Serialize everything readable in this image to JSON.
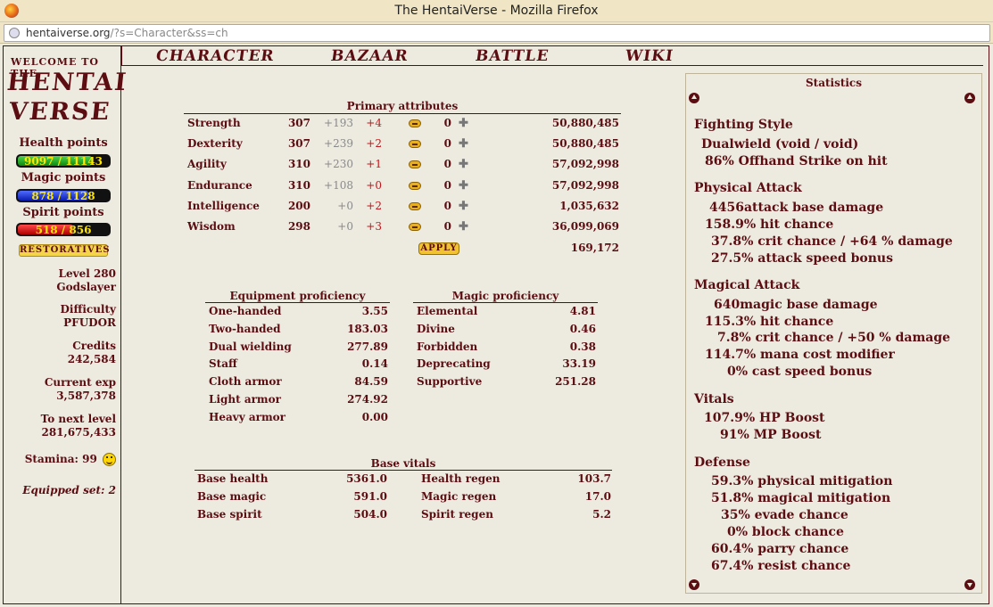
{
  "browser": {
    "window_title": "The HentaiVerse - Mozilla Firefox",
    "url_host": "hentaiverse.org",
    "url_path": "/?s=Character&ss=ch"
  },
  "menu": [
    "CHARACTER",
    "BAZAAR",
    "BATTLE",
    "WIKI"
  ],
  "left": {
    "welcome": "WELCOME TO THE",
    "logo_line1": "HENTAI",
    "logo_line2": "VERSE",
    "health_label": "Health points",
    "health_value": "9097 / 11143",
    "health_fraction": 0.816,
    "magic_label": "Magic points",
    "magic_value": "878 / 1128",
    "magic_fraction": 0.778,
    "spirit_label": "Spirit points",
    "spirit_value": "518 / 856",
    "spirit_fraction": 0.605,
    "restoratives": "RESTORATIVES",
    "level": "Level 280",
    "title": "Godslayer",
    "difficulty_label": "Difficulty",
    "difficulty_value": "PFUDOR",
    "credits_label": "Credits",
    "credits_value": "242,584",
    "exp_label": "Current exp",
    "exp_value": "3,587,378",
    "next_label": "To next level",
    "next_value": "281,675,433",
    "stamina": "Stamina: 99",
    "equipped_set": "Equipped set: 2"
  },
  "primary": {
    "title": "Primary attributes",
    "rows": [
      {
        "name": "Strength",
        "base": "307",
        "bonus": "+193",
        "delta": "+4",
        "spent": "0",
        "exp": "50,880,485"
      },
      {
        "name": "Dexterity",
        "base": "307",
        "bonus": "+239",
        "delta": "+2",
        "spent": "0",
        "exp": "50,880,485"
      },
      {
        "name": "Agility",
        "base": "310",
        "bonus": "+230",
        "delta": "+1",
        "spent": "0",
        "exp": "57,092,998"
      },
      {
        "name": "Endurance",
        "base": "310",
        "bonus": "+108",
        "delta": "+0",
        "spent": "0",
        "exp": "57,092,998"
      },
      {
        "name": "Intelligence",
        "base": "200",
        "bonus": "+0",
        "delta": "+2",
        "spent": "0",
        "exp": "1,035,632"
      },
      {
        "name": "Wisdom",
        "base": "298",
        "bonus": "+0",
        "delta": "+3",
        "spent": "0",
        "exp": "36,099,069"
      }
    ],
    "apply": "APPLY",
    "total_exp": "169,172"
  },
  "equipment_prof": {
    "title": "Equipment proficiency",
    "rows": [
      {
        "name": "One-handed",
        "value": "3.55"
      },
      {
        "name": "Two-handed",
        "value": "183.03"
      },
      {
        "name": "Dual wielding",
        "value": "277.89"
      },
      {
        "name": "Staff",
        "value": "0.14"
      },
      {
        "name": "Cloth armor",
        "value": "84.59"
      },
      {
        "name": "Light armor",
        "value": "274.92"
      },
      {
        "name": "Heavy armor",
        "value": "0.00"
      }
    ]
  },
  "magic_prof": {
    "title": "Magic proficiency",
    "rows": [
      {
        "name": "Elemental",
        "value": "4.81"
      },
      {
        "name": "Divine",
        "value": "0.46"
      },
      {
        "name": "Forbidden",
        "value": "0.38"
      },
      {
        "name": "Deprecating",
        "value": "33.19"
      },
      {
        "name": "Supportive",
        "value": "251.28"
      }
    ]
  },
  "base_vitals": {
    "title": "Base vitals",
    "rows": [
      {
        "name": "Base health",
        "value": "5361.0",
        "regen_name": "Health regen",
        "regen_value": "103.7"
      },
      {
        "name": "Base magic",
        "value": "591.0",
        "regen_name": "Magic regen",
        "regen_value": "17.0"
      },
      {
        "name": "Base spirit",
        "value": "504.0",
        "regen_name": "Spirit regen",
        "regen_value": "5.2"
      }
    ]
  },
  "statistics": {
    "title": "Statistics",
    "fighting_style": {
      "head": "Fighting Style",
      "lines": [
        "Dualwield (void / void)",
        "86% Offhand Strike on hit"
      ]
    },
    "physical": {
      "head": "Physical Attack",
      "lines": [
        "4456attack base damage",
        "158.9% hit chance",
        "37.8% crit chance / +64 % damage",
        "27.5% attack speed bonus"
      ]
    },
    "magical": {
      "head": "Magical Attack",
      "lines": [
        "640magic base damage",
        "115.3% hit chance",
        "7.8% crit chance / +50 % damage",
        "114.7% mana cost modifier",
        "0% cast speed bonus"
      ]
    },
    "vitals": {
      "head": "Vitals",
      "lines": [
        "107.9% HP Boost",
        "91% MP Boost"
      ]
    },
    "defense": {
      "head": "Defense",
      "lines": [
        "59.3% physical mitigation",
        "51.8% magical mitigation",
        "35% evade chance",
        "0% block chance",
        "60.4% parry chance",
        "67.4% resist chance"
      ]
    }
  }
}
